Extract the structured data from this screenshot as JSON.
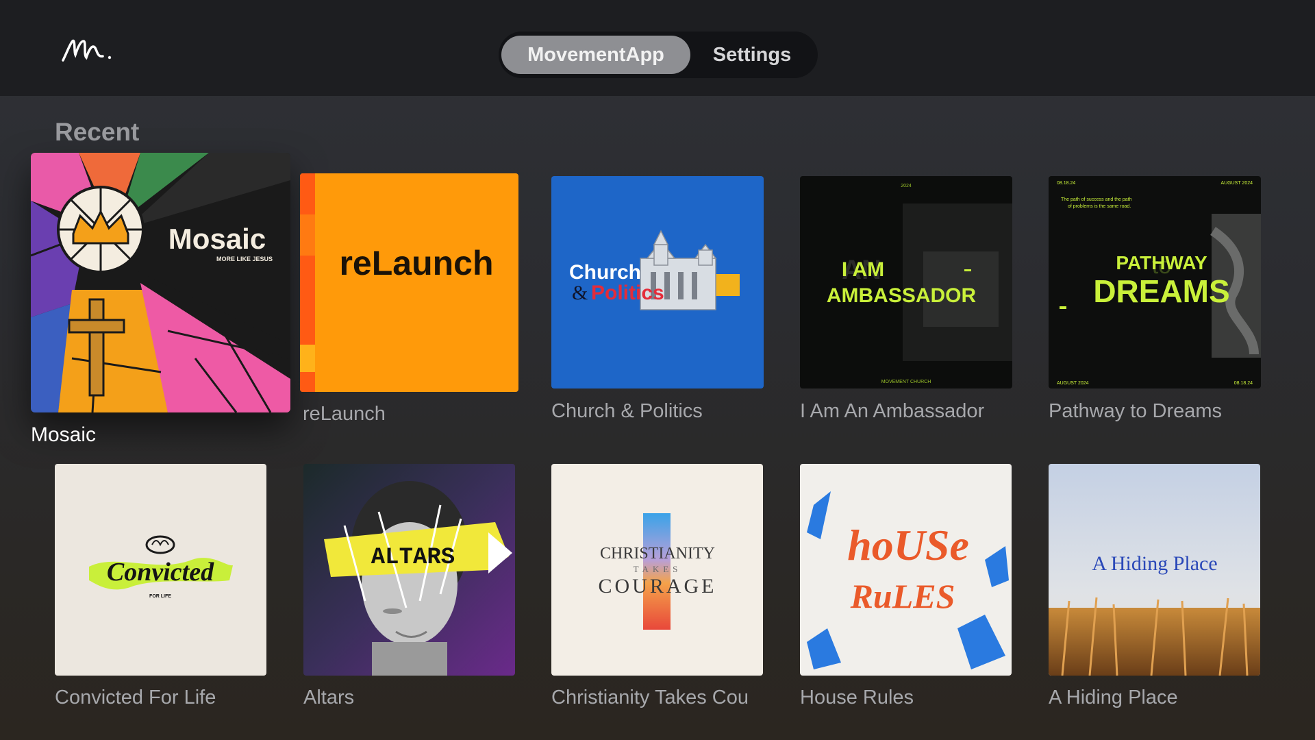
{
  "header": {
    "tabs": [
      {
        "label": "MovementApp",
        "active": true
      },
      {
        "label": "Settings",
        "active": false
      }
    ]
  },
  "section": {
    "title": "Recent"
  },
  "items": [
    {
      "title": "Mosaic",
      "art": {
        "main": "Mosaic",
        "sub": "MORE LIKE JESUS"
      }
    },
    {
      "title": "reLaunch",
      "art": {
        "main": "reLaunch"
      }
    },
    {
      "title": "Church & Politics",
      "art": {
        "word1": "Church",
        "word2": "&",
        "word3": "Politics"
      }
    },
    {
      "title": "I Am An Ambassador",
      "art": {
        "line1": "I AM",
        "line2": "AMBASSADOR",
        "ghost": "AN",
        "year": "2024",
        "footer": "MOVEMENT CHURCH"
      }
    },
    {
      "title": "Pathway to Dreams",
      "art": {
        "line1": "PATHWAY",
        "line2": "DREAMS",
        "ghost": "to",
        "quote1": "The path of success and the path",
        "quote2": "of problems is the same road.",
        "date_tl": "08.18.24",
        "date_tr": "AUGUST 2024",
        "date_bl": "AUGUST 2024",
        "date_br": "08.18.24"
      }
    },
    {
      "title": "Convicted For Life",
      "art": {
        "main": "Convicted",
        "sub": "FOR LIFE"
      }
    },
    {
      "title": "Altars",
      "art": {
        "main": "ALTARS"
      }
    },
    {
      "title": "Christianity Takes Cou",
      "art": {
        "line1": "CHRISTIANITY",
        "line2": "TAKES",
        "line3": "COURAGE"
      }
    },
    {
      "title": "House Rules",
      "art": {
        "line1": "hoUSe",
        "line2": "RuLES"
      }
    },
    {
      "title": "A Hiding Place",
      "art": {
        "main": "A Hiding Place"
      }
    }
  ],
  "colors": {
    "accent_orange": "#ff9a0a",
    "politics_blue": "#1e66c8",
    "neon_green": "#c9f03a"
  }
}
